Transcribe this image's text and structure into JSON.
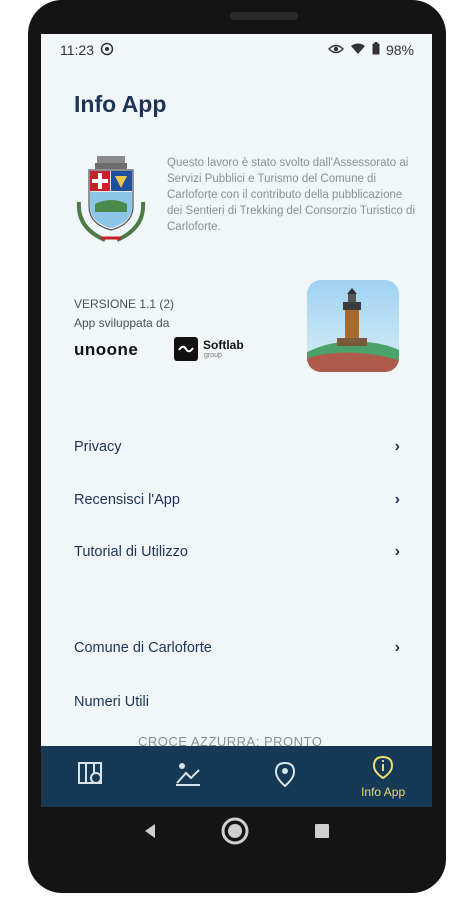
{
  "status_bar": {
    "time": "11:23",
    "battery": "98%",
    "icons": [
      "whatsapp-icon",
      "eye-icon",
      "wifi-icon",
      "battery-icon"
    ]
  },
  "page": {
    "title": "Info App",
    "intro": "Questo lavoro è stato svolto dall'Assessorato ai Servizi Pubblici e Turismo del Comune di Carloforte con il contributo della pubblicazione dei Sentieri di Trekking del Consorzio Turistico di Carloforte.",
    "version": "VERSIONE 1.1 (2)",
    "developed_by": "App sviluppata da",
    "brands": {
      "unoone": "unoone",
      "softlab": "Softlab",
      "softlab_sub": "group"
    }
  },
  "menu": [
    {
      "label": "Privacy",
      "chevron": "›"
    },
    {
      "label": "Recensisci l'App",
      "chevron": "›"
    },
    {
      "label": "Tutorial di Utilizzo",
      "chevron": "›"
    },
    {
      "label": "Comune di Carloforte",
      "chevron": "›"
    },
    {
      "label": "Numeri Utili",
      "chevron": ""
    }
  ],
  "peek_text": "CROCE AZZURRA: PRONTO",
  "navbar": {
    "tabs": [
      {
        "icon": "map-grid-icon",
        "label": ""
      },
      {
        "icon": "trekking-icon",
        "label": ""
      },
      {
        "icon": "location-pin-icon",
        "label": ""
      },
      {
        "icon": "info-icon",
        "label": "Info App"
      }
    ]
  },
  "colors": {
    "accent": "#163a55",
    "active_tab": "#e9dc70",
    "title": "#1d3458"
  }
}
